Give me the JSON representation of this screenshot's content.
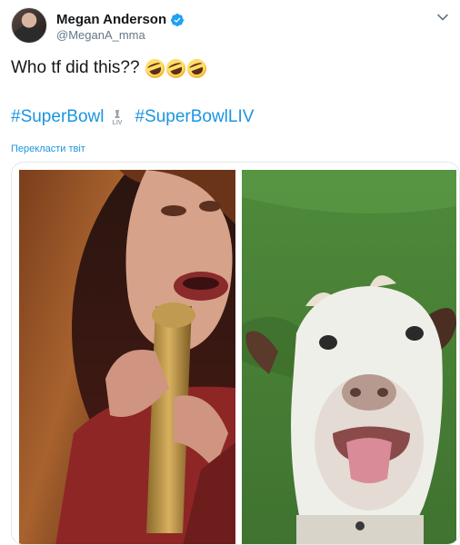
{
  "tweet": {
    "display_name": "Megan Anderson",
    "handle": "@MeganA_mma",
    "verified": true,
    "text": "Who tf did this??",
    "emojis": [
      "rolling-on-floor-laughing",
      "rolling-on-floor-laughing",
      "rolling-on-floor-laughing"
    ],
    "hashtags": [
      "#SuperBowl",
      "#SuperBowlLIV"
    ],
    "translate_link": "Перекласти твіт"
  },
  "media": {
    "left_image": "singer-with-microphone",
    "right_image": "goat-with-tongue-out"
  },
  "colors": {
    "link": "#1b95e0",
    "name": "#14171a",
    "secondary": "#657786",
    "verified": "#1da1f2"
  }
}
